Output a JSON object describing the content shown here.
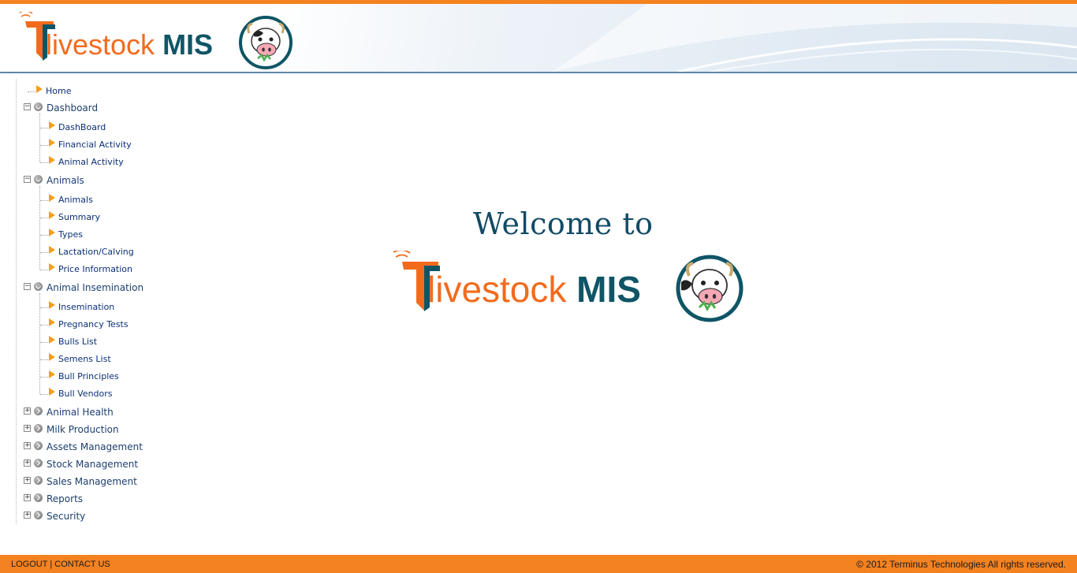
{
  "header": {
    "logo_word": "livestock",
    "logo_mis": "MIS"
  },
  "nav": {
    "home": "Home",
    "groups": [
      {
        "label": "Dashboard",
        "expanded": true,
        "items": [
          "DashBoard",
          "Financial Activity",
          "Animal Activity"
        ]
      },
      {
        "label": "Animals",
        "expanded": true,
        "items": [
          "Animals",
          "Summary",
          "Types",
          "Lactation/Calving",
          "Price Information"
        ]
      },
      {
        "label": "Animal Insemination",
        "expanded": true,
        "items": [
          "Insemination",
          "Pregnancy Tests",
          "Bulls List",
          "Semens List",
          "Bull Principles",
          "Bull Vendors"
        ]
      },
      {
        "label": "Animal Health",
        "expanded": false,
        "items": []
      },
      {
        "label": "Milk Production",
        "expanded": false,
        "items": []
      },
      {
        "label": "Assets Management",
        "expanded": false,
        "items": []
      },
      {
        "label": "Stock Management",
        "expanded": false,
        "items": []
      },
      {
        "label": "Sales Management",
        "expanded": false,
        "items": []
      },
      {
        "label": "Reports",
        "expanded": false,
        "items": []
      },
      {
        "label": "Security",
        "expanded": false,
        "items": []
      }
    ]
  },
  "main": {
    "welcome": "Welcome to",
    "logo_word": "livestock",
    "logo_mis": "MIS"
  },
  "footer": {
    "logout": "LOGOUT",
    "separator": "|",
    "contact": "CONTACT US",
    "copyright": "© 2012 Terminus Technologies All rights reserved."
  },
  "colors": {
    "accent_orange": "#f58220",
    "logo_orange": "#f26b1d",
    "logo_teal": "#0f5566",
    "nav_text": "#0b2f78"
  },
  "icons": {
    "leaf": "orange-triangle-arrow-icon",
    "group_open": "gray-circle-chevron-down-icon",
    "group_closed": "gray-circle-chevron-right-icon",
    "expand": "plus-box-icon",
    "collapse": "minus-box-icon",
    "mascot": "cow-face-icon"
  }
}
